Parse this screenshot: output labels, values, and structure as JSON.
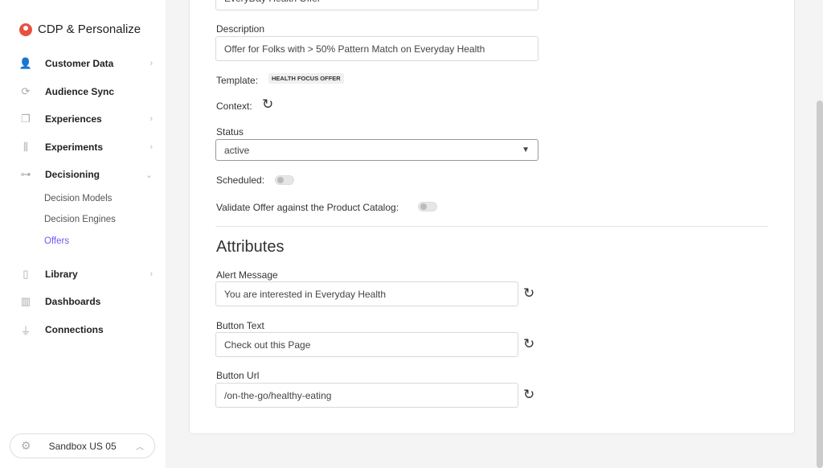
{
  "sidebar": {
    "brand": "CDP & Personalize",
    "items": [
      {
        "label": "Customer Data",
        "icon": "user-icon",
        "chevron": "right"
      },
      {
        "label": "Audience Sync",
        "icon": "sync-icon"
      },
      {
        "label": "Experiences",
        "icon": "experiences-icon",
        "chevron": "right"
      },
      {
        "label": "Experiments",
        "icon": "flask-icon",
        "chevron": "right"
      },
      {
        "label": "Decisioning",
        "icon": "flow-icon",
        "chevron": "down"
      },
      {
        "label": "Library",
        "icon": "book-icon",
        "chevron": "right"
      },
      {
        "label": "Dashboards",
        "icon": "chart-icon"
      },
      {
        "label": "Connections",
        "icon": "plug-icon"
      }
    ],
    "subitems": [
      {
        "label": "Decision Models"
      },
      {
        "label": "Decision Engines"
      },
      {
        "label": "Offers",
        "active": true
      }
    ],
    "sandbox": "Sandbox US 05"
  },
  "form": {
    "name_value": "EveryDay Health Offer",
    "description_label": "Description",
    "description_value": "Offer for Folks with > 50% Pattern Match on Everyday Health",
    "template_label": "Template:",
    "template_value": "HEALTH FOCUS OFFER",
    "context_label": "Context:",
    "status_label": "Status",
    "status_value": "active",
    "scheduled_label": "Scheduled:",
    "scheduled_on": false,
    "validate_label": "Validate Offer against the Product Catalog:",
    "validate_on": false
  },
  "attributes": {
    "title": "Attributes",
    "fields": [
      {
        "label": "Alert Message",
        "value": "You are interested in Everyday Health"
      },
      {
        "label": "Button Text",
        "value": "Check out this Page"
      },
      {
        "label": "Button Url",
        "value": "/on-the-go/healthy-eating"
      }
    ]
  },
  "colors": {
    "accent": "#6b5bf3",
    "brand": "#e8513f"
  }
}
